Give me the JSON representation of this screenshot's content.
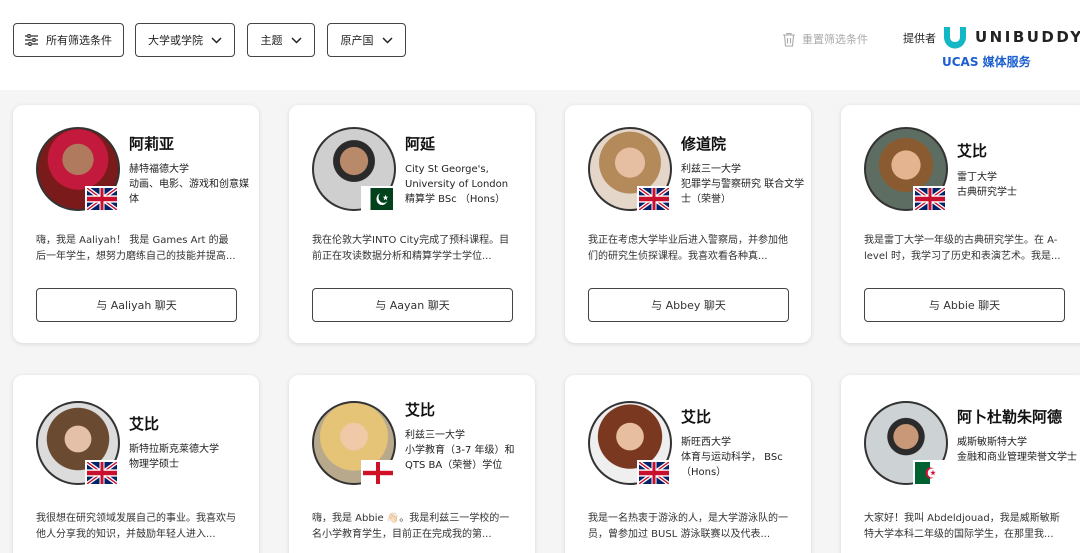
{
  "filters": {
    "all_label": "所有筛选条件",
    "university_label": "大学或学院",
    "subject_label": "主题",
    "country_label": "原产国",
    "reset_label": "重置筛选条件"
  },
  "brand": {
    "provided_by": "提供者",
    "wordmark": "UNIBUDDY",
    "tagline": "UCAS 媒体服务"
  },
  "cards": [
    {
      "name": "阿莉亚",
      "university": "赫特福德大学",
      "course": "动画、电影、游戏和创意媒体",
      "flag": "uk-flag-icon",
      "bio": "嗨，我是 Aaliyah！ 我是 Games Art 的最后一年学生，想努力磨练自己的技能并提高...",
      "chat": "与 Aaliyah 聊天"
    },
    {
      "name": "阿延",
      "university": "City St George's, University of London",
      "course": "精算学 BSc （Hons）",
      "flag": "pakistan-flag-icon",
      "bio": "我在伦敦大学INTO City完成了预科课程。目前正在攻读数据分析和精算学学士学位...",
      "chat": "与 Aayan 聊天"
    },
    {
      "name": "修道院",
      "university": "利兹三一大学",
      "course": "犯罪学与警察研究 联合文学士（荣誉）",
      "flag": "uk-flag-icon",
      "bio": "我正在考虑大学毕业后进入警察局，并参加他们的研究生侦探课程。我喜欢看各种真...",
      "chat": "与 Abbey 聊天"
    },
    {
      "name": "艾比",
      "university": "雷丁大学",
      "course": "古典研究学士",
      "flag": "uk-flag-icon",
      "bio": "我是雷丁大学一年级的古典研究学生。在 A-level 时，我学习了历史和表演艺术。我是...",
      "chat": "与 Abbie 聊天"
    },
    {
      "name": "艾比",
      "university": "斯特拉斯克莱德大学",
      "course": "物理学硕士",
      "flag": "uk-flag-icon",
      "bio": "我很想在研究领域发展自己的事业。我喜欢与他人分享我的知识，并鼓励年轻人进入..."
    },
    {
      "name": "艾比",
      "university": "利兹三一大学",
      "course": "小学教育（3-7 年级）和 QTS BA（荣誉）学位",
      "flag": "england-flag-icon",
      "bio": "嗨，我是 Abbie 👋🏻。我是利兹三一学校的一名小学教育学生，目前正在完成我的第..."
    },
    {
      "name": "艾比",
      "university": "斯旺西大学",
      "course": "体育与运动科学， BSc （Hons）",
      "flag": "uk-flag-icon",
      "bio": "我是一名热衷于游泳的人，是大学游泳队的一员，曾参加过 BUSL 游泳联赛以及代表..."
    },
    {
      "name": "阿卜杜勒朱阿德",
      "university": "威斯敏斯特大学",
      "course": "金融和商业管理荣誉文学士",
      "flag": "algeria-flag-icon",
      "bio": "大家好！我叫 Abdeldjouad，我是威斯敏斯特大学本科二年级的国际学生，在那里我..."
    }
  ]
}
